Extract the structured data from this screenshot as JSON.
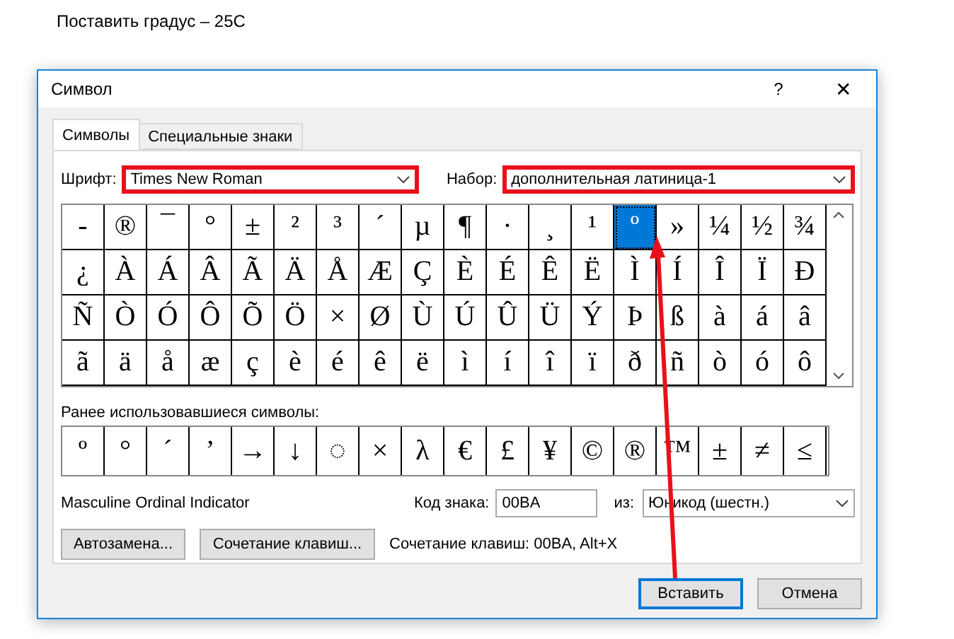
{
  "document": {
    "text": "Поставить градус – 25С"
  },
  "window": {
    "title": "Символ",
    "help": "?",
    "close": "✕"
  },
  "tabs": [
    {
      "label": "Символы",
      "selected": true
    },
    {
      "label": "Специальные знаки",
      "selected": false
    }
  ],
  "font_field": {
    "label": "Шрифт:",
    "value": "Times New Roman",
    "highlighted": true
  },
  "subset_field": {
    "label": "Набор:",
    "value": "дополнительная латиница-1",
    "highlighted": true
  },
  "symbols": [
    [
      {
        "char": "-",
        "selected": false
      },
      {
        "char": "®",
        "selected": false
      },
      {
        "char": "¯",
        "selected": false
      },
      {
        "char": "°",
        "selected": false
      },
      {
        "char": "±",
        "selected": false
      },
      {
        "char": "²",
        "selected": false
      },
      {
        "char": "³",
        "selected": false
      },
      {
        "char": "´",
        "selected": false
      },
      {
        "char": "µ",
        "selected": false
      },
      {
        "char": "¶",
        "selected": false
      },
      {
        "char": "·",
        "selected": false
      },
      {
        "char": "¸",
        "selected": false
      },
      {
        "char": "¹",
        "selected": false
      },
      {
        "char": "º",
        "selected": true
      },
      {
        "char": "»",
        "selected": false
      },
      {
        "char": "¼",
        "selected": false
      },
      {
        "char": "½",
        "selected": false
      },
      {
        "char": "¾",
        "selected": false
      }
    ],
    [
      {
        "char": "¿",
        "selected": false
      },
      {
        "char": "À",
        "selected": false
      },
      {
        "char": "Á",
        "selected": false
      },
      {
        "char": "Â",
        "selected": false
      },
      {
        "char": "Ã",
        "selected": false
      },
      {
        "char": "Ä",
        "selected": false
      },
      {
        "char": "Å",
        "selected": false
      },
      {
        "char": "Æ",
        "selected": false
      },
      {
        "char": "Ç",
        "selected": false
      },
      {
        "char": "È",
        "selected": false
      },
      {
        "char": "É",
        "selected": false
      },
      {
        "char": "Ê",
        "selected": false
      },
      {
        "char": "Ë",
        "selected": false
      },
      {
        "char": "Ì",
        "selected": false
      },
      {
        "char": "Í",
        "selected": false
      },
      {
        "char": "Î",
        "selected": false
      },
      {
        "char": "Ï",
        "selected": false
      },
      {
        "char": "Ð",
        "selected": false
      }
    ],
    [
      {
        "char": "Ñ",
        "selected": false
      },
      {
        "char": "Ò",
        "selected": false
      },
      {
        "char": "Ó",
        "selected": false
      },
      {
        "char": "Ô",
        "selected": false
      },
      {
        "char": "Õ",
        "selected": false
      },
      {
        "char": "Ö",
        "selected": false
      },
      {
        "char": "×",
        "selected": false
      },
      {
        "char": "Ø",
        "selected": false
      },
      {
        "char": "Ù",
        "selected": false
      },
      {
        "char": "Ú",
        "selected": false
      },
      {
        "char": "Û",
        "selected": false
      },
      {
        "char": "Ü",
        "selected": false
      },
      {
        "char": "Ý",
        "selected": false
      },
      {
        "char": "Þ",
        "selected": false
      },
      {
        "char": "ß",
        "selected": false
      },
      {
        "char": "à",
        "selected": false
      },
      {
        "char": "á",
        "selected": false
      },
      {
        "char": "â",
        "selected": false
      }
    ],
    [
      {
        "char": "ã",
        "selected": false
      },
      {
        "char": "ä",
        "selected": false
      },
      {
        "char": "å",
        "selected": false
      },
      {
        "char": "æ",
        "selected": false
      },
      {
        "char": "ç",
        "selected": false
      },
      {
        "char": "è",
        "selected": false
      },
      {
        "char": "é",
        "selected": false
      },
      {
        "char": "ê",
        "selected": false
      },
      {
        "char": "ë",
        "selected": false
      },
      {
        "char": "ì",
        "selected": false
      },
      {
        "char": "í",
        "selected": false
      },
      {
        "char": "î",
        "selected": false
      },
      {
        "char": "ï",
        "selected": false
      },
      {
        "char": "ð",
        "selected": false
      },
      {
        "char": "ñ",
        "selected": false
      },
      {
        "char": "ò",
        "selected": false
      },
      {
        "char": "ó",
        "selected": false
      },
      {
        "char": "ô",
        "selected": false
      }
    ]
  ],
  "recent": {
    "label": "Ранее использовавшиеся символы:",
    "chars": [
      "º",
      "°",
      "´",
      "’",
      "→",
      "↓",
      "◌",
      "×",
      "λ",
      "€",
      "£",
      "¥",
      "©",
      "®",
      "™",
      "±",
      "≠",
      "≤"
    ]
  },
  "char_name": "Masculine Ordinal Indicator",
  "code_field": {
    "label": "Код знака:",
    "value": "00BA"
  },
  "from_field": {
    "label": "из:",
    "value": "Юникод (шестн.)"
  },
  "autocorrect_button": "Автозамена...",
  "shortcut_button": "Сочетание клавиш...",
  "shortcut_text": "Сочетание клавиш: 00BA, Alt+X",
  "insert_button": "Вставить",
  "cancel_button": "Отмена",
  "annotation_arrow": true
}
